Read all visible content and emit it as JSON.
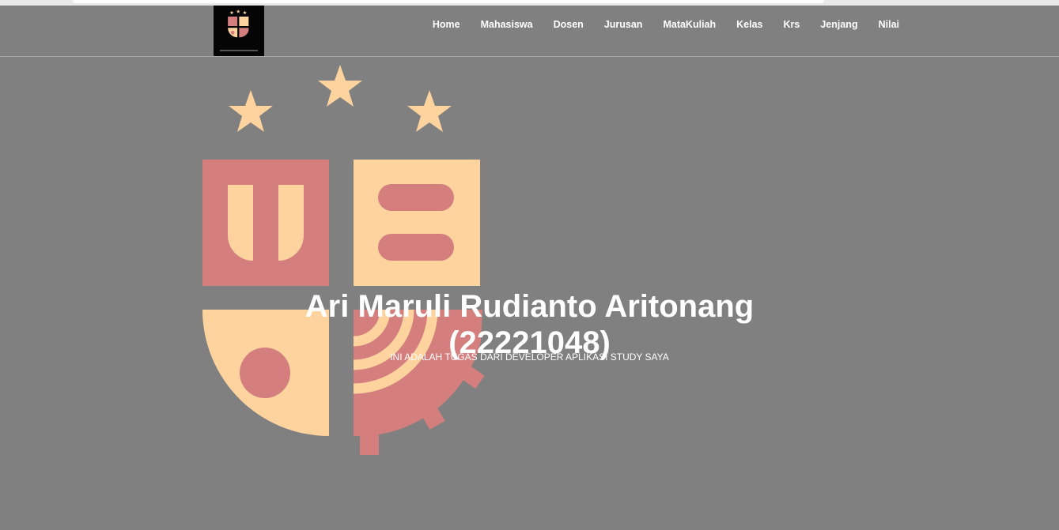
{
  "navbar": {
    "logo_icon": "university-crest-logo",
    "logo_caption": "Fakultas Teknologi & Ilmu Komputer",
    "items": [
      {
        "label": "Home"
      },
      {
        "label": "Mahasiswa"
      },
      {
        "label": "Dosen"
      },
      {
        "label": "Jurusan"
      },
      {
        "label": "MataKuliah"
      },
      {
        "label": "Kelas"
      },
      {
        "label": "Krs"
      },
      {
        "label": "Jenjang"
      },
      {
        "label": "Nilai"
      }
    ]
  },
  "hero": {
    "title_line1": "Ari Maruli Rudianto Aritonang",
    "title_line2": "(22221048)",
    "subtitle": "INI ADALAH TUGAS DARI DEVELOPER APLIKASI STUDY SAYA",
    "emblem_icon": "university-crest-emblem"
  },
  "colors": {
    "background": "#808080",
    "crest_peach": "#ffd39e",
    "crest_red": "#d47e7e",
    "text": "#ffffff"
  }
}
